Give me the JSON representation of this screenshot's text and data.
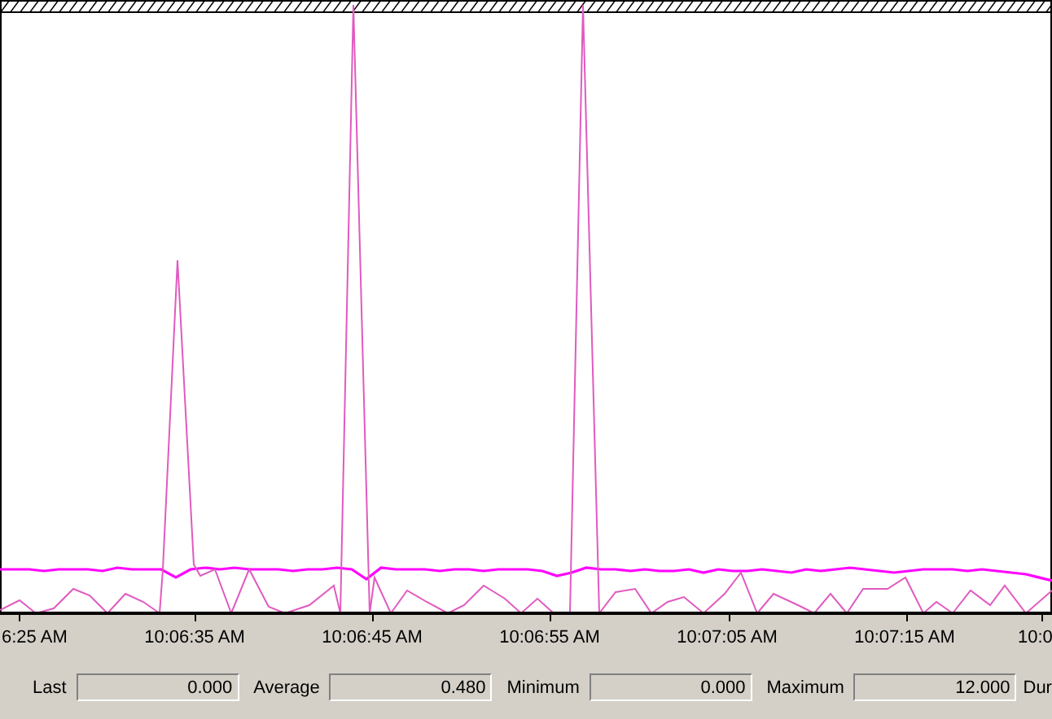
{
  "chart": {
    "time_axis_labels": [
      "6:25 AM",
      "10:06:35 AM",
      "10:06:45 AM",
      "10:06:55 AM",
      "10:07:05 AM",
      "10:07:15 AM",
      "10:0"
    ]
  },
  "stats": [
    {
      "label": "Last",
      "value": "0.000"
    },
    {
      "label": "Average",
      "value": "0.480"
    },
    {
      "label": "Minimum",
      "value": "0.000"
    },
    {
      "label": "Maximum",
      "value": "12.000"
    }
  ],
  "stats_cut_label": "Dur"
}
